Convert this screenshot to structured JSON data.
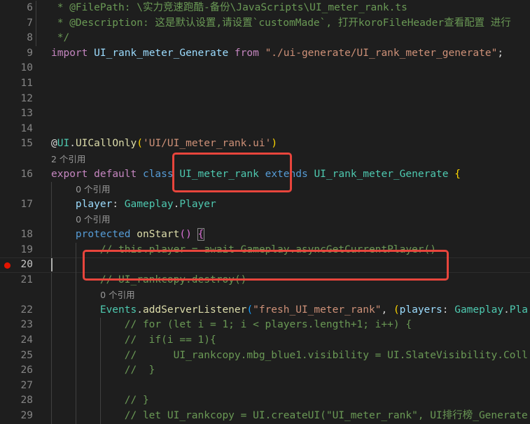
{
  "editor": {
    "theme_colors": {
      "background": "#1e1e1e",
      "comment": "#6a9955",
      "keyword": "#c586c0",
      "type": "#4ec9b0",
      "string": "#ce9178",
      "annotation_box": "#e8453c",
      "breakpoint": "#e51400"
    },
    "current_line": 20,
    "breakpoint_line": 20,
    "rows": [
      {
        "n": "6",
        "indent": 0,
        "guides": [
          51
        ],
        "tokens": [
          [
            " * @FilePath: \\实力竞速跑酷-备份\\JavaScripts\\UI_meter_rank.ts",
            "cm"
          ]
        ]
      },
      {
        "n": "7",
        "indent": 0,
        "guides": [
          51
        ],
        "tokens": [
          [
            " * @Description: 这是默认设置,请设置`customMade`, 打开koroFileHeader查看配置 进行",
            "cm"
          ]
        ]
      },
      {
        "n": "8",
        "indent": 0,
        "guides": [
          51
        ],
        "tokens": [
          [
            " */",
            "cm"
          ]
        ]
      },
      {
        "n": "9",
        "indent": 0,
        "guides": [],
        "tokens": [
          [
            "import",
            "kw"
          ],
          [
            " ",
            "pl"
          ],
          [
            "UI_rank_meter_Generate",
            "va"
          ],
          [
            " ",
            "pl"
          ],
          [
            "from",
            "kw"
          ],
          [
            " ",
            "pl"
          ],
          [
            "\"./ui-generate/UI_rank_meter_generate\"",
            "st"
          ],
          [
            ";",
            "pl"
          ]
        ]
      },
      {
        "n": "10",
        "indent": 0,
        "guides": [],
        "tokens": []
      },
      {
        "n": "11",
        "indent": 0,
        "guides": [],
        "tokens": []
      },
      {
        "n": "12",
        "indent": 0,
        "guides": [],
        "tokens": []
      },
      {
        "n": "13",
        "indent": 0,
        "guides": [],
        "tokens": []
      },
      {
        "n": "14",
        "indent": 0,
        "guides": [],
        "tokens": []
      },
      {
        "n": "15",
        "indent": 0,
        "guides": [],
        "tokens": [
          [
            "@",
            "pl"
          ],
          [
            "UI",
            "ty"
          ],
          [
            ".",
            "pl"
          ],
          [
            "UICallOnly",
            "fn"
          ],
          [
            "(",
            "b1"
          ],
          [
            "'UI/UI_meter_rank.ui'",
            "st"
          ],
          [
            ")",
            "b1"
          ]
        ]
      },
      {
        "lens": "2 个引用",
        "indent": 0,
        "guides": []
      },
      {
        "n": "16",
        "indent": 0,
        "guides": [],
        "tokens": [
          [
            "export",
            "kw"
          ],
          [
            " ",
            "pl"
          ],
          [
            "default",
            "kw"
          ],
          [
            " ",
            "pl"
          ],
          [
            "class",
            "bl"
          ],
          [
            " ",
            "pl"
          ],
          [
            "UI_meter_rank",
            "ty"
          ],
          [
            " ",
            "pl"
          ],
          [
            "extends",
            "bl"
          ],
          [
            " ",
            "pl"
          ],
          [
            "UI_rank_meter_Generate",
            "ty"
          ],
          [
            " ",
            "pl"
          ],
          [
            "{",
            "b1"
          ]
        ]
      },
      {
        "lens": "0 个引用",
        "indent": 4,
        "guides": [
          73
        ]
      },
      {
        "n": "17",
        "indent": 4,
        "guides": [
          73
        ],
        "tokens": [
          [
            "    ",
            "pl"
          ],
          [
            "player",
            "va"
          ],
          [
            ": ",
            "pl"
          ],
          [
            "Gameplay",
            "ty"
          ],
          [
            ".",
            "pl"
          ],
          [
            "Player",
            "ty"
          ]
        ]
      },
      {
        "lens": "0 个引用",
        "indent": 4,
        "guides": [
          73
        ]
      },
      {
        "n": "18",
        "indent": 4,
        "guides": [
          73
        ],
        "tokens": [
          [
            "    ",
            "pl"
          ],
          [
            "protected",
            "bl"
          ],
          [
            " ",
            "pl"
          ],
          [
            "onStart",
            "fn"
          ],
          [
            "()",
            "b2"
          ],
          [
            " ",
            "pl"
          ],
          [
            "{",
            "b2 match"
          ]
        ]
      },
      {
        "n": "19",
        "indent": 8,
        "guides": [
          73,
          108
        ],
        "tokens": [
          [
            "        ",
            "pl"
          ],
          [
            "// this.player = await Gameplay.asyncGetCurrentPlayer()",
            "cm"
          ]
        ]
      },
      {
        "n": "20",
        "indent": 8,
        "guides": [
          108
        ],
        "tokens": [],
        "current": true,
        "breakpoint": true
      },
      {
        "n": "21",
        "indent": 8,
        "guides": [
          73,
          108
        ],
        "tokens": [
          [
            "        ",
            "pl"
          ],
          [
            "// UI_rankcopy.destroy()",
            "cm"
          ]
        ]
      },
      {
        "lens": "0 个引用",
        "indent": 8,
        "guides": [
          73,
          108
        ]
      },
      {
        "n": "22",
        "indent": 8,
        "guides": [
          73,
          108
        ],
        "tokens": [
          [
            "        ",
            "pl"
          ],
          [
            "Events",
            "ty"
          ],
          [
            ".",
            "pl"
          ],
          [
            "addServerListener",
            "fn"
          ],
          [
            "(",
            "b3"
          ],
          [
            "\"fresh_UI_meter_rank\"",
            "st"
          ],
          [
            ", ",
            "pl"
          ],
          [
            "(",
            "b1"
          ],
          [
            "players",
            "va"
          ],
          [
            ": ",
            "pl"
          ],
          [
            "Gameplay",
            "ty"
          ],
          [
            ".",
            "pl"
          ],
          [
            "Pla",
            "ty"
          ]
        ]
      },
      {
        "n": "23",
        "indent": 12,
        "guides": [
          73,
          108,
          143
        ],
        "tokens": [
          [
            "            ",
            "pl"
          ],
          [
            "// for (let i = 1; i < players.length+1; i++) {",
            "cm"
          ]
        ]
      },
      {
        "n": "24",
        "indent": 12,
        "guides": [
          73,
          108,
          143
        ],
        "tokens": [
          [
            "            ",
            "pl"
          ],
          [
            "//  if(i == 1){",
            "cm"
          ]
        ]
      },
      {
        "n": "25",
        "indent": 12,
        "guides": [
          73,
          108,
          143
        ],
        "tokens": [
          [
            "            ",
            "pl"
          ],
          [
            "//      UI_rankcopy.mbg_blue1.visibility = UI.SlateVisibility.Coll",
            "cm"
          ]
        ]
      },
      {
        "n": "26",
        "indent": 12,
        "guides": [
          73,
          108,
          143
        ],
        "tokens": [
          [
            "            ",
            "pl"
          ],
          [
            "//  }",
            "cm"
          ]
        ]
      },
      {
        "n": "27",
        "indent": 12,
        "guides": [
          73,
          108,
          143
        ],
        "tokens": []
      },
      {
        "n": "28",
        "indent": 12,
        "guides": [
          73,
          108,
          143
        ],
        "tokens": [
          [
            "            ",
            "pl"
          ],
          [
            "// }",
            "cm"
          ]
        ]
      },
      {
        "n": "29",
        "indent": 12,
        "guides": [
          73,
          108,
          143
        ],
        "tokens": [
          [
            "            ",
            "pl"
          ],
          [
            "// let UI_rankcopy = UI.createUI(\"UI_meter_rank\", UI排行榜_Generate",
            "cm"
          ]
        ]
      }
    ]
  }
}
